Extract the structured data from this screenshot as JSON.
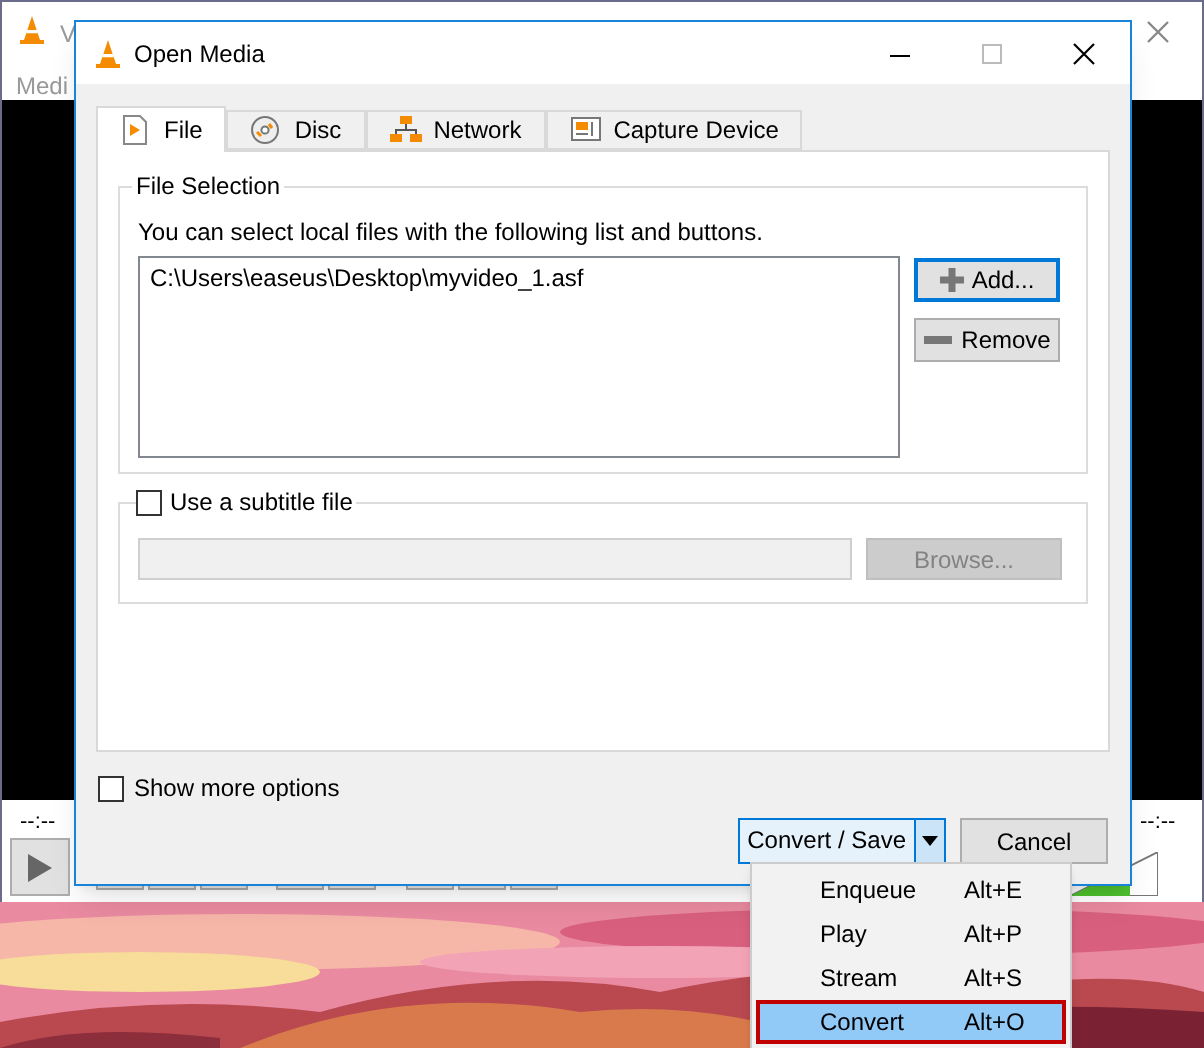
{
  "background_window": {
    "title": "V",
    "menu": "Medi",
    "time_elapsed": "--:--",
    "time_total": "--:--"
  },
  "dialog": {
    "title": "Open Media",
    "tabs": [
      {
        "label": "File",
        "selected": true
      },
      {
        "label": "Disc",
        "selected": false
      },
      {
        "label": "Network",
        "selected": false
      },
      {
        "label": "Capture Device",
        "selected": false
      }
    ],
    "file_selection": {
      "title": "File Selection",
      "hint": "You can select local files with the following list and buttons.",
      "files": [
        "C:\\Users\\easeus\\Desktop\\myvideo_1.asf"
      ],
      "add_button": "Add...",
      "remove_button": "Remove"
    },
    "subtitle": {
      "label": "Use a subtitle file",
      "checked": false,
      "browse_button": "Browse..."
    },
    "show_more_options": {
      "label": "Show more options",
      "checked": false
    },
    "convert_save_button": "Convert / Save",
    "cancel_button": "Cancel"
  },
  "dropdown_menu": [
    {
      "label": "Enqueue",
      "shortcut": "Alt+E",
      "selected": false
    },
    {
      "label": "Play",
      "shortcut": "Alt+P",
      "selected": false
    },
    {
      "label": "Stream",
      "shortcut": "Alt+S",
      "selected": false
    },
    {
      "label": "Convert",
      "shortcut": "Alt+O",
      "selected": true
    }
  ]
}
